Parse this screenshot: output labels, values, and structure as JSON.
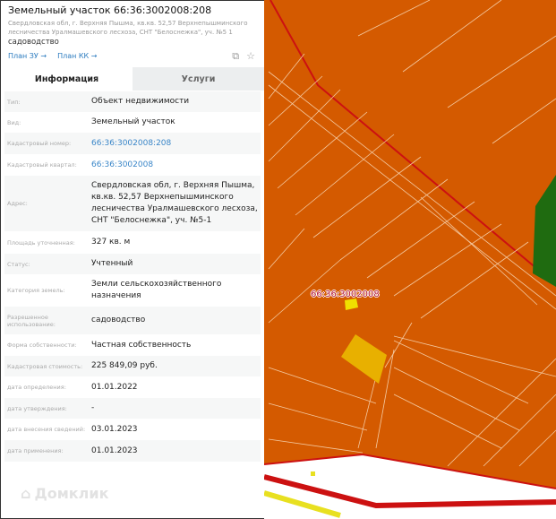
{
  "header": {
    "title": "Земельный участок 66:36:3002008:208",
    "address": "Свердловская обл, г. Верхняя Пышма, кв.кв. 52,57 Верхнепышминского лесничества Уралмашевского лесхоза, СНТ \"Белоснежка\", уч. №5 1",
    "use": "садоводство",
    "links": [
      "План ЗУ →",
      "План КК →"
    ],
    "icons": [
      "search-document-icon",
      "star-icon"
    ]
  },
  "tabs": [
    {
      "label": "Информация",
      "active": true
    },
    {
      "label": "Услуги",
      "active": false
    }
  ],
  "rows": [
    {
      "label": "Тип:",
      "value": "Объект недвижимости"
    },
    {
      "label": "Вид:",
      "value": "Земельный участок"
    },
    {
      "label": "Кадастровый номер:",
      "value": "66:36:3002008:208",
      "link": true
    },
    {
      "label": "Кадастровый квартал:",
      "value": "66:36:3002008",
      "link": true
    },
    {
      "label": "Адрес:",
      "value": "Свердловская обл, г. Верхняя Пышма, кв.кв. 52,57 Верхнепышминского лесничества Уралмашевского лесхоза, СНТ \"Белоснежка\", уч. №5-1"
    },
    {
      "label": "Площадь уточненная:",
      "value": "327 кв. м"
    },
    {
      "label": "Статус:",
      "value": "Учтенный"
    },
    {
      "label": "Категория земель:",
      "value": "Земли сельскохозяйственного назначения"
    },
    {
      "label": "Разрешенное использование:",
      "value": "садоводство"
    },
    {
      "label": "Форма собственности:",
      "value": "Частная собственность"
    },
    {
      "label": "Кадастровая стоимость:",
      "value": "225 849,09 руб."
    },
    {
      "label": "дата определения:",
      "value": "01.01.2022"
    },
    {
      "label": "дата утверждения:",
      "value": "-"
    },
    {
      "label": "дата внесения сведений:",
      "value": "03.01.2023"
    },
    {
      "label": "дата применения:",
      "value": "01.01.2023"
    }
  ],
  "logo": "Домклик",
  "map": {
    "quarter_label": "66:36:3002008",
    "colors": {
      "land": "#d45a00",
      "boundary": "#cc1111",
      "parcel_highlight": "#e8b000",
      "forest": "#1f6b10",
      "road": "#ffffff"
    }
  }
}
